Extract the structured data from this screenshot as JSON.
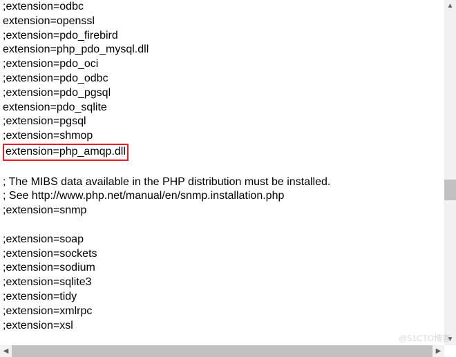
{
  "lines": [
    ";extension=odbc",
    "extension=openssl",
    ";extension=pdo_firebird",
    "extension=php_pdo_mysql.dll",
    ";extension=pdo_oci",
    ";extension=pdo_odbc",
    ";extension=pdo_pgsql",
    "extension=pdo_sqlite",
    ";extension=pgsql",
    ";extension=shmop"
  ],
  "highlighted_line": "extension=php_amqp.dll",
  "comment_block": [
    "; The MIBS data available in the PHP distribution must be installed.",
    "; See http://www.php.net/manual/en/snmp.installation.php",
    ";extension=snmp"
  ],
  "lines_after": [
    ";extension=soap",
    ";extension=sockets",
    ";extension=sodium",
    ";extension=sqlite3",
    ";extension=tidy",
    ";extension=xmlrpc",
    ";extension=xsl"
  ],
  "watermark": "@51CTO博客",
  "arrows": {
    "up": "▲",
    "down": "▼",
    "left": "◀",
    "right": "▶"
  }
}
